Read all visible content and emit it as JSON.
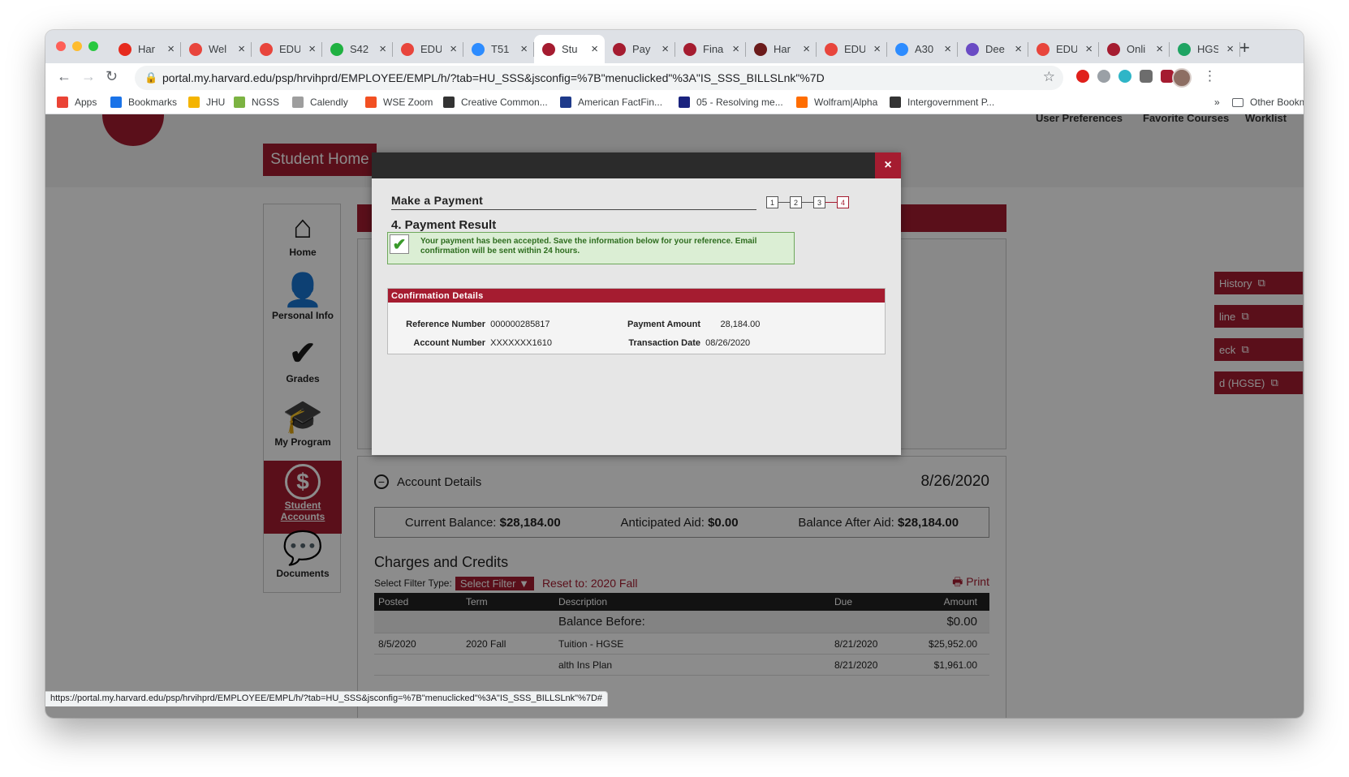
{
  "browser": {
    "tabs": [
      {
        "title": "Har",
        "color": "#e62b1e"
      },
      {
        "title": "Wel",
        "color": "#e8453c"
      },
      {
        "title": "EDU",
        "color": "#e8453c"
      },
      {
        "title": "S42",
        "color": "#1fb141"
      },
      {
        "title": "EDU",
        "color": "#e8453c"
      },
      {
        "title": "T51",
        "color": "#2d8cff"
      },
      {
        "title": "Stu",
        "color": "#a51c30",
        "active": true
      },
      {
        "title": "Pay",
        "color": "#a51c30"
      },
      {
        "title": "Fina",
        "color": "#a51c30"
      },
      {
        "title": "Har",
        "color": "#6b1b1b"
      },
      {
        "title": "EDU",
        "color": "#e8453c"
      },
      {
        "title": "A30",
        "color": "#2d8cff"
      },
      {
        "title": "Dee",
        "color": "#6a4bc4"
      },
      {
        "title": "EDU",
        "color": "#e8453c"
      },
      {
        "title": "Onli",
        "color": "#a51c30"
      },
      {
        "title": "HGS",
        "color": "#1fa463"
      }
    ],
    "url_domain": "portal.my.harvard.edu",
    "url_path": "/psp/hrvihprd/EMPLOYEE/EMPL/h/?tab=HU_SSS&jsconfig=%7B\"menuclicked\"%3A\"IS_SSS_BILLSLnk\"%7D",
    "bookmarks": [
      "Apps",
      "Bookmarks",
      "JHU",
      "NGSS",
      "Calendly",
      "WSE Zoom",
      "Creative Common...",
      "American FactFin...",
      "05 - Resolving me...",
      "Wolfram|Alpha",
      "Intergovernment P..."
    ],
    "other_bookmarks": "Other Bookmarks",
    "status_url": "https://portal.my.harvard.edu/psp/hrvihprd/EMPLOYEE/EMPL/h/?tab=HU_SSS&jsconfig=%7B\"menuclicked\"%3A\"IS_SSS_BILLSLnk\"%7D#"
  },
  "header": {
    "user_preferences": "User Preferences",
    "favorite_courses": "Favorite Courses",
    "worklist": "Worklist",
    "student_home": "Student Home"
  },
  "sidebar": {
    "items": [
      {
        "label": "Home",
        "icon": "home-icon",
        "glyph": "⌂"
      },
      {
        "label": "Personal Info",
        "icon": "person-icon",
        "glyph": "👤"
      },
      {
        "label": "Grades",
        "icon": "checkmark-icon",
        "glyph": "✔"
      },
      {
        "label": "My Program",
        "icon": "graduation-cap-icon",
        "glyph": "🎓"
      },
      {
        "label": "Student Accounts",
        "icon": "dollar-icon",
        "glyph": "$",
        "active": true
      },
      {
        "label": "Documents",
        "icon": "chat-bubbles-icon",
        "glyph": "💬"
      }
    ]
  },
  "links": {
    "history": "History",
    "online": "line",
    "check": "eck",
    "hgse": "d (HGSE)"
  },
  "account": {
    "title": "Account Details",
    "date": "8/26/2020",
    "current_balance_label": "Current Balance:",
    "current_balance": "$28,184.00",
    "anticipated_aid_label": "Anticipated Aid:",
    "anticipated_aid": "$0.00",
    "balance_after_aid_label": "Balance After Aid:",
    "balance_after_aid": "$28,184.00",
    "charges_title": "Charges and Credits",
    "filter_label": "Select Filter Type:",
    "select_filter": "Select Filter ▼",
    "reset": "Reset to: 2020 Fall",
    "print": "🖶 Print",
    "columns": [
      "Posted",
      "Term",
      "Description",
      "Due",
      "Amount"
    ],
    "balance_before_label": "Balance Before:",
    "balance_before": "$0.00",
    "rows": [
      {
        "posted": "8/5/2020",
        "term": "2020 Fall",
        "description": "Tuition - HGSE",
        "due": "8/21/2020",
        "amount": "$25,952.00"
      },
      {
        "posted": "",
        "term": "",
        "description": "alth Ins Plan",
        "due": "8/21/2020",
        "amount": "$1,961.00"
      }
    ]
  },
  "modal": {
    "close": "×",
    "title": "Make a Payment",
    "steps": [
      "1",
      "2",
      "3",
      "4"
    ],
    "current_step": 4,
    "result_title": "4. Payment Result",
    "success_message": "Your payment has been accepted. Save the information below for your reference.  Email confirmation will be sent within 24 hours.",
    "confirmation_header": "Confirmation Details",
    "reference_label": "Reference Number",
    "reference_value": "000000285817",
    "account_label": "Account Number",
    "account_value": "XXXXXXX1610",
    "payment_amount_label": "Payment Amount",
    "payment_amount_value": "28,184.00",
    "transaction_date_label": "Transaction Date",
    "transaction_date_value": "08/26/2020"
  }
}
